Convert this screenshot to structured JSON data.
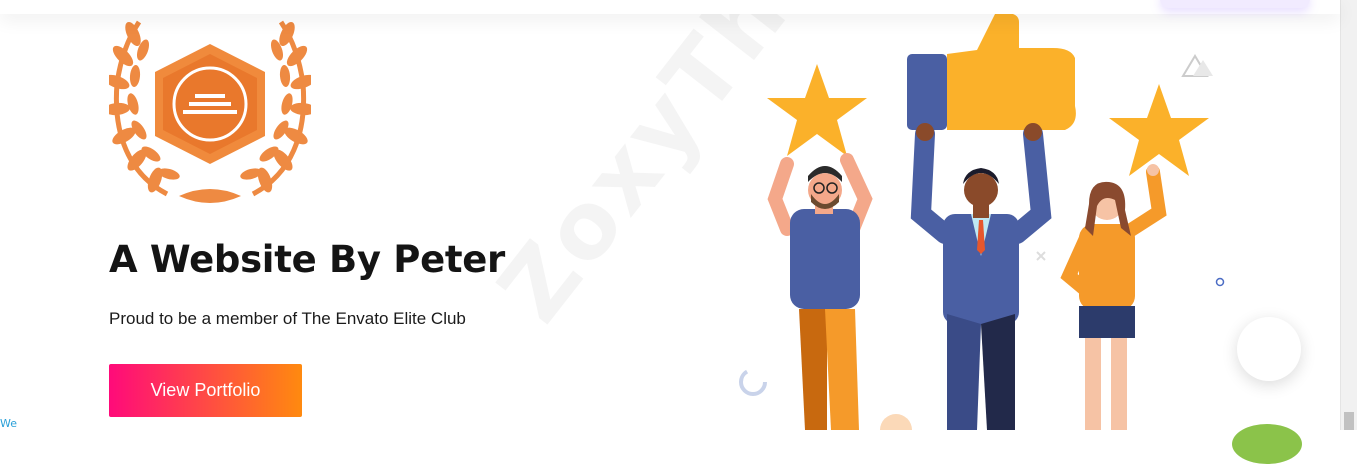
{
  "hero": {
    "title": "A Website By Peter",
    "subtitle": "Proud to be a member of The Envato Elite Club",
    "cta_label": "View Portfolio"
  },
  "watermark": {
    "text": "ZoxyThemes"
  },
  "corner_widget": {
    "text": "We"
  },
  "colors": {
    "cta_gradient_start": "#ff0a7a",
    "cta_gradient_end": "#ff8a0f",
    "badge_orange": "#f08a3c",
    "star_yellow": "#fbb12a",
    "title_text": "#141414"
  },
  "icons": {
    "badge": "elite-author-laurel-badge",
    "illustration": "people-holding-stars-and-thumbs-up",
    "chat": "chat-launcher"
  }
}
